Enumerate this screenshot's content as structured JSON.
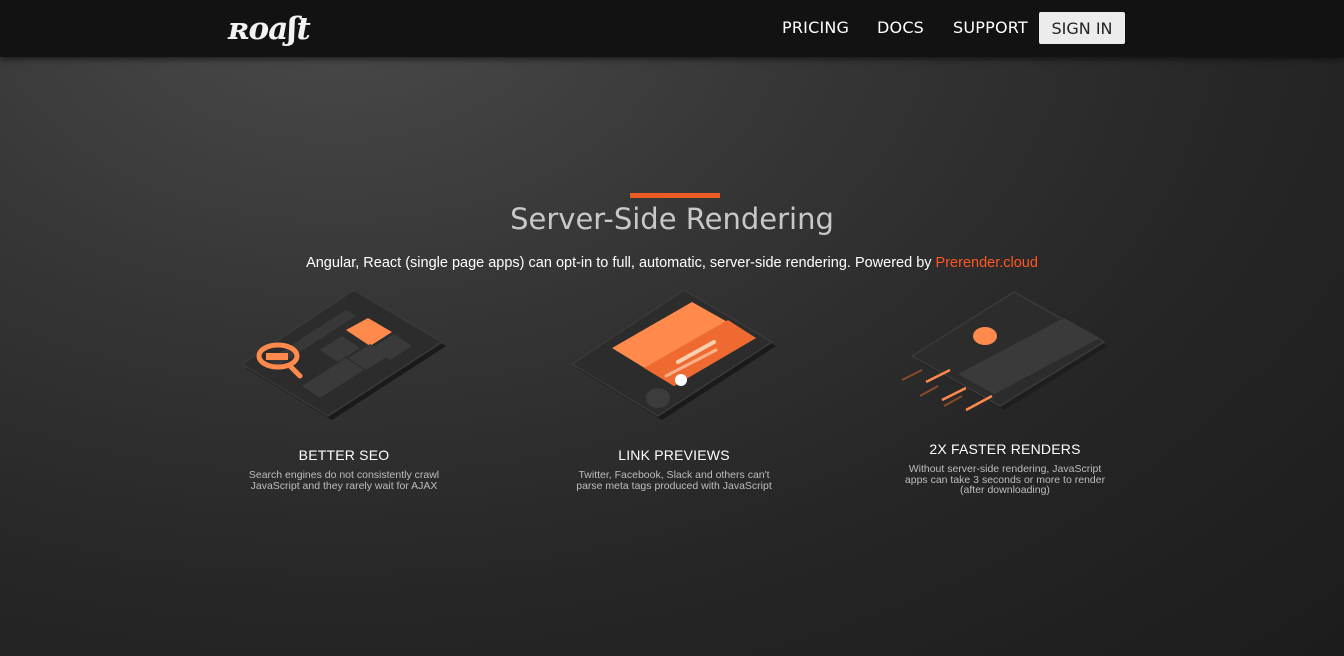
{
  "header": {
    "logo_text": "Roast",
    "nav": {
      "pricing": "PRICING",
      "docs": "DOCS",
      "support": "SUPPORT",
      "sign_in": "SIGN IN"
    }
  },
  "hero": {
    "title": "Server-Side Rendering",
    "subtitle_text": "Angular, React (single page apps) can opt-in to full, automatic, server-side rendering. Powered by ",
    "subtitle_link": "Prerender.cloud"
  },
  "features": [
    {
      "icon": "seo-tablet-magnifier-icon",
      "title": "BETTER SEO",
      "desc_line1": "Search engines do not consistently crawl",
      "desc_line2": "JavaScript and they rarely wait for AJAX"
    },
    {
      "icon": "link-preview-tablet-icon",
      "title": "LINK PREVIEWS",
      "desc_line1": "Twitter, Facebook, Slack and others can't",
      "desc_line2": "parse meta tags produced with JavaScript"
    },
    {
      "icon": "fast-render-device-icon",
      "title": "2X FASTER RENDERS",
      "desc_line1": "Without server-side rendering, JavaScript",
      "desc_line2": "apps can take 3 seconds or more to render",
      "desc_line3": "(after downloading)"
    }
  ],
  "colors": {
    "accent": "#ee5a24",
    "link": "#ff5722",
    "illustration_orange": "#ff8a4c",
    "topbar": "#121212"
  }
}
